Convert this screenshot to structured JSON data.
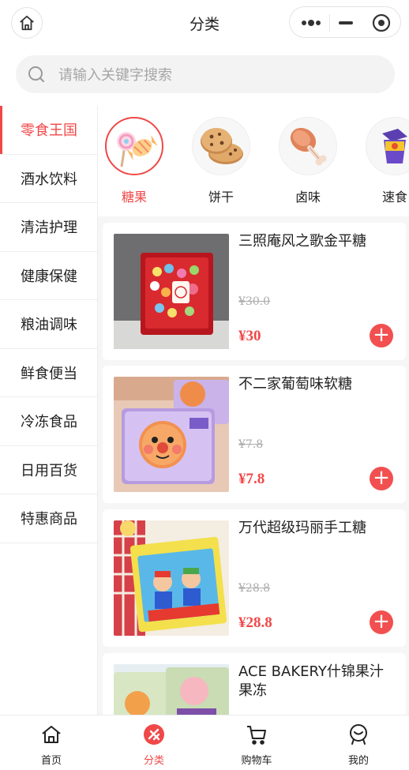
{
  "header": {
    "title": "分类",
    "home_icon": "home-icon",
    "more_icon": "more-dots-icon",
    "minimize_icon": "minimize-icon",
    "close_icon": "target-close-icon"
  },
  "search": {
    "placeholder": "请输入关键字搜索",
    "icon": "search-icon"
  },
  "sidebar": {
    "active_color": "#f04848",
    "items": [
      {
        "label": "零食王国",
        "active": true
      },
      {
        "label": "酒水饮料"
      },
      {
        "label": "清洁护理"
      },
      {
        "label": "健康保健"
      },
      {
        "label": "粮油调味"
      },
      {
        "label": "鲜食便当"
      },
      {
        "label": "冷冻食品"
      },
      {
        "label": "日用百货"
      },
      {
        "label": "特惠商品"
      }
    ]
  },
  "subcategories": [
    {
      "label": "糖果",
      "icon": "candy-icon",
      "active": true
    },
    {
      "label": "饼干",
      "icon": "cookie-icon"
    },
    {
      "label": "卤味",
      "icon": "drumstick-icon"
    },
    {
      "label": "速食",
      "icon": "instant-food-icon"
    }
  ],
  "products": [
    {
      "name": "三照庵风之歌金平糖",
      "old_price": "¥30.0",
      "price": "¥30",
      "image": "candy-box-image"
    },
    {
      "name": "不二家葡萄味软糖",
      "old_price": "¥7.8",
      "price": "¥7.8",
      "image": "anpanman-gummy-image"
    },
    {
      "name": "万代超级玛丽手工糖",
      "old_price": "¥28.8",
      "price": "¥28.8",
      "image": "mario-candy-image"
    },
    {
      "name": "ACE BAKERY什锦果汁果冻",
      "old_price": "",
      "price": "",
      "image": "fruit-jelly-image"
    }
  ],
  "tabbar": {
    "active_color": "#f04848",
    "tabs": [
      {
        "label": "首页",
        "icon": "home-icon"
      },
      {
        "label": "分类",
        "icon": "category-icon",
        "active": true
      },
      {
        "label": "购物车",
        "icon": "cart-icon"
      },
      {
        "label": "我的",
        "icon": "profile-icon"
      }
    ]
  }
}
